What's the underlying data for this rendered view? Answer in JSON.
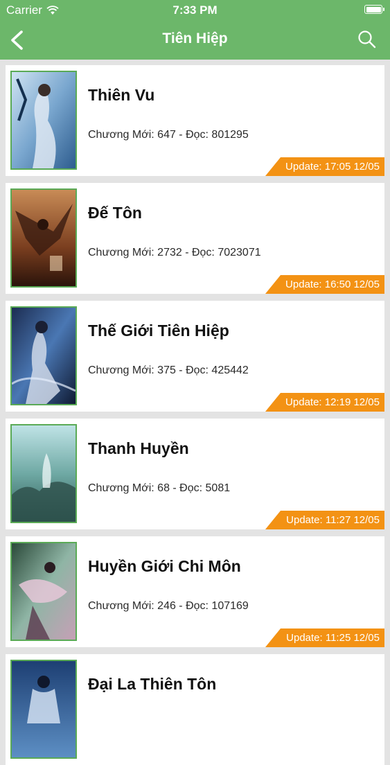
{
  "status_bar": {
    "carrier": "Carrier",
    "time": "7:33 PM"
  },
  "nav": {
    "title": "Tiên Hiệp"
  },
  "books": [
    {
      "title": "Thiên Vu",
      "stats": "Chương Mới: 647 - Đọc: 801295",
      "update": "Update: 17:05 12/05"
    },
    {
      "title": "Đế Tôn",
      "stats": "Chương Mới: 2732 - Đọc: 7023071",
      "update": "Update: 16:50 12/05"
    },
    {
      "title": "Thế Giới Tiên Hiệp",
      "stats": "Chương Mới: 375 - Đọc: 425442",
      "update": "Update: 12:19 12/05"
    },
    {
      "title": "Thanh Huyền",
      "stats": "Chương Mới: 68 - Đọc: 5081",
      "update": "Update: 11:27 12/05"
    },
    {
      "title": "Huyền Giới Chi Môn",
      "stats": "Chương Mới: 246 - Đọc: 107169",
      "update": "Update: 11:25 12/05"
    },
    {
      "title": "Đại La Thiên Tôn",
      "stats": "",
      "update": ""
    }
  ],
  "colors": {
    "primary": "#6cb76a",
    "badge": "#f39214",
    "cover_border": "#5aaa56"
  }
}
